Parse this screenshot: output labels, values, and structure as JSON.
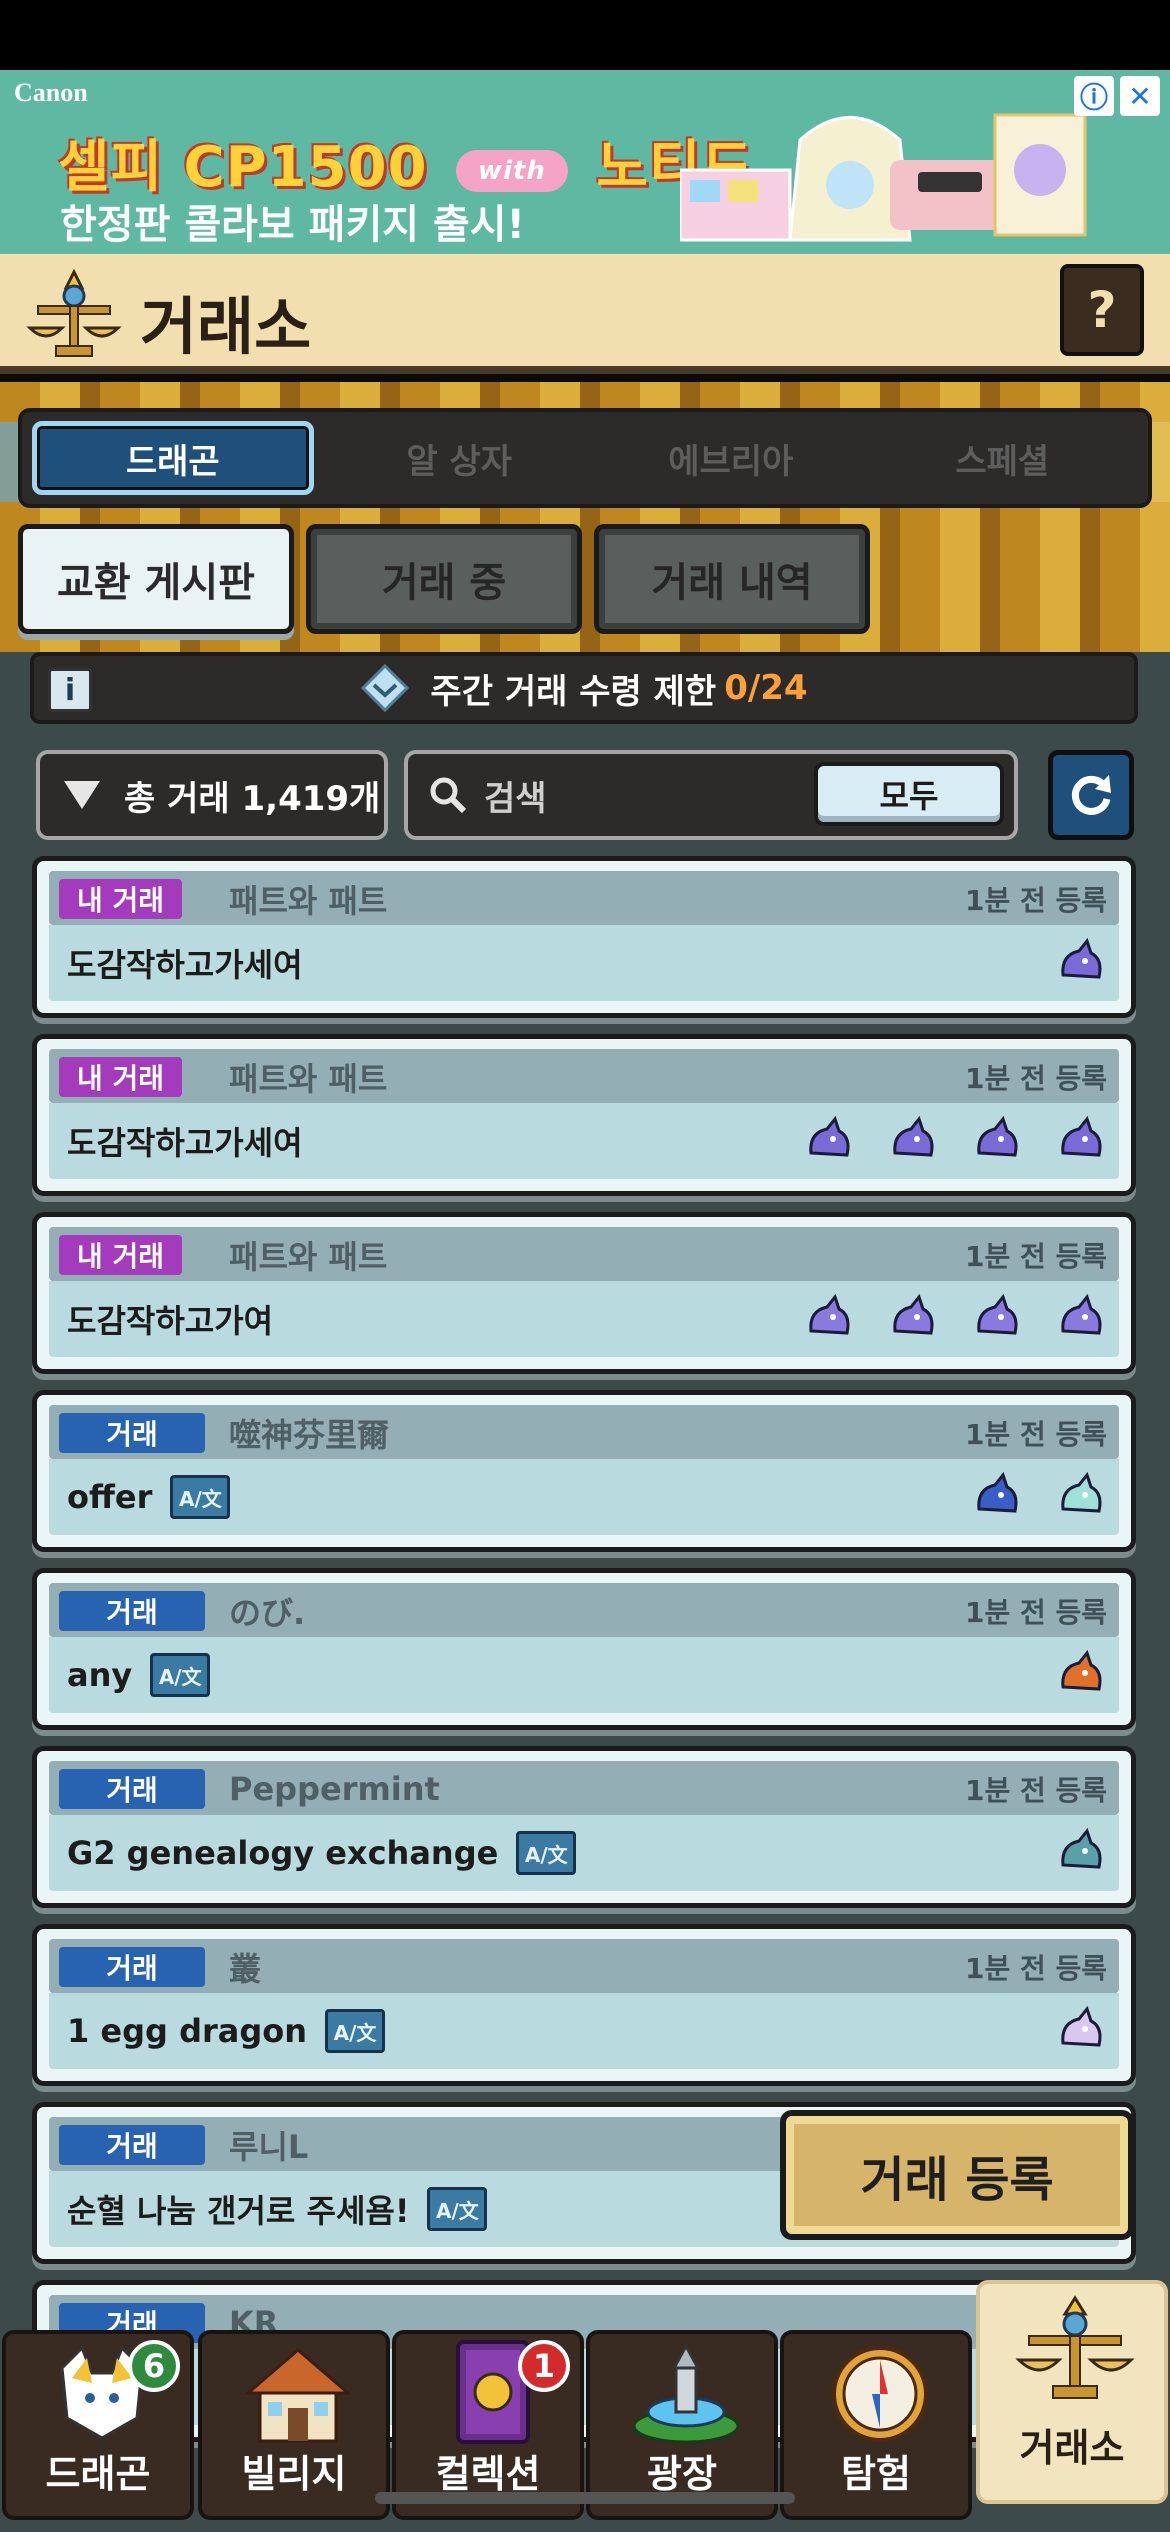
{
  "ad": {
    "brand": "Canon",
    "headline_left": "셀피 CP1500",
    "headline_with": "with",
    "headline_right": "노티드",
    "sub": "한정판 콜라보 패키지 출시!",
    "info_icon": "ⓘ",
    "close_icon": "✕"
  },
  "header": {
    "title": "거래소",
    "help_label": "?"
  },
  "top_tabs": [
    {
      "label": "드래곤",
      "active": true
    },
    {
      "label": "알 상자"
    },
    {
      "label": "에브리아"
    },
    {
      "label": "스페셜"
    }
  ],
  "sub_tabs": [
    {
      "label": "교환 게시판",
      "active": true
    },
    {
      "label": "거래 중"
    },
    {
      "label": "거래 내역"
    }
  ],
  "info": {
    "icon_label": "i",
    "text": "주간 거래 수령 제한",
    "count": "0/24"
  },
  "filter": {
    "label": "총 거래 1,419개"
  },
  "search": {
    "placeholder": "검색",
    "all_label": "모두"
  },
  "trades": [
    {
      "badge": "내 거래",
      "mine": true,
      "user": "패트와 패트",
      "when": "1분 전 등록",
      "message": "도감작하고가세여",
      "translatable": false,
      "pets": [
        "purple-dragon-icon"
      ]
    },
    {
      "badge": "내 거래",
      "mine": true,
      "user": "패트와 패트",
      "when": "1분 전 등록",
      "message": "도감작하고가세여",
      "translatable": false,
      "pets": [
        "purple-dragon-icon",
        "purple-dragon-icon",
        "purple-dragon-icon",
        "purple-dragon-icon"
      ]
    },
    {
      "badge": "내 거래",
      "mine": true,
      "user": "패트와 패트",
      "when": "1분 전 등록",
      "message": "도감작하고가여",
      "translatable": false,
      "pets": [
        "winged-dragon-icon",
        "winged-dragon-icon",
        "winged-dragon-icon",
        "winged-dragon-icon"
      ]
    },
    {
      "badge": "거래",
      "mine": false,
      "user": "噬神芬里爾",
      "when": "1분 전 등록",
      "message": "offer",
      "translatable": true,
      "pets": [
        "blue-dragon-icon",
        "serpent-dragon-icon"
      ]
    },
    {
      "badge": "거래",
      "mine": false,
      "user": "のび.",
      "when": "1분 전 등록",
      "message": "any",
      "translatable": true,
      "pets": [
        "flame-dragon-icon"
      ]
    },
    {
      "badge": "거래",
      "mine": false,
      "user": "Peppermint",
      "when": "1분 전 등록",
      "message": "G2 genealogy exchange",
      "translatable": true,
      "pets": [
        "egg-dragon-icon"
      ]
    },
    {
      "badge": "거래",
      "mine": false,
      "user": "叢",
      "when": "1분 전 등록",
      "message": "1 egg dragon",
      "translatable": true,
      "pets": [
        "white-dragon-icon"
      ]
    },
    {
      "badge": "거래",
      "mine": false,
      "user": "루니L",
      "when": "",
      "message": "순혈 나눔 갠거로 주세욤!",
      "translatable": true,
      "pets": []
    },
    {
      "badge": "거래",
      "mine": false,
      "user": "KR",
      "when": "",
      "message": "",
      "translatable": false,
      "pets": []
    }
  ],
  "translate_label": "A/文",
  "register_label": "거래 등록",
  "nav": [
    {
      "label": "드래곤",
      "icon": "dragon-nav-icon",
      "badge": "6",
      "badge_color": "#2e8b3e"
    },
    {
      "label": "빌리지",
      "icon": "village-nav-icon"
    },
    {
      "label": "컬렉션",
      "icon": "collection-nav-icon",
      "badge": "1",
      "badge_color": "#d32b2b"
    },
    {
      "label": "광장",
      "icon": "plaza-nav-icon"
    },
    {
      "label": "탐험",
      "icon": "compass-nav-icon"
    },
    {
      "label": "거래소",
      "icon": "scale-nav-icon",
      "active": true
    }
  ],
  "colors": {
    "mine_badge": "#a43bbd",
    "trade_badge": "#2763b0",
    "active_tab": "#1f4f7b",
    "limit_count": "#ff9f3a"
  }
}
